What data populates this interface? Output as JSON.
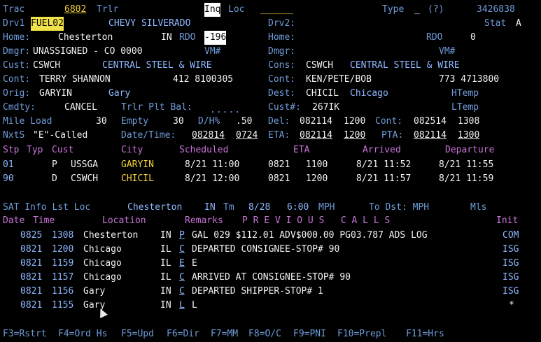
{
  "header": {
    "trac_label": "Trac",
    "trac_value": "6802",
    "trlr_label": "Trlr",
    "inq_label": "Inq",
    "loc_label": "Loc",
    "type_label": "Type",
    "help": "(?)",
    "record_id": "3426838"
  },
  "drv1": {
    "label": "Drv1",
    "code": "FUEL02",
    "vehicle": "CHEVY SILVERADO"
  },
  "drv2": {
    "label": "Drv2:",
    "stat_label": "Stat",
    "stat_value": "A"
  },
  "home_left": {
    "label": "Home:",
    "city": "Chesterton",
    "state": "IN",
    "rdo_label": "RDO",
    "rdo_value": "-196"
  },
  "home_right": {
    "label": "Home:",
    "rdo_label": "RDO",
    "rdo_value": "0"
  },
  "dmgr_left": {
    "label": "Dmgr:",
    "value": "UNASSIGNED - CO 0000",
    "vm_label": "VM#"
  },
  "dmgr_right": {
    "label": "Dmgr:",
    "vm_label": "VM#"
  },
  "cust": {
    "label": "Cust:",
    "code": "CSWCH",
    "name": "CENTRAL STEEL & WIRE"
  },
  "cons": {
    "label": "Cons:",
    "code": "CSWCH",
    "name": "CENTRAL STEEL & WIRE"
  },
  "cont_left": {
    "label": "Cont:",
    "name": "TERRY SHANNON",
    "phone": "412 8100305"
  },
  "cont_right": {
    "label": "Cont:",
    "name": "KEN/PETE/BOB",
    "phone": "773 4713800"
  },
  "orig": {
    "label": "Orig:",
    "code": "GARYIN",
    "city": "Gary"
  },
  "dest": {
    "label": "Dest:",
    "code": "CHICIL",
    "city": "Chicago",
    "htemp_label": "HTemp"
  },
  "cmdty": {
    "label": "Cmdty:",
    "value": "CANCEL",
    "trlr_plt_label": "Trlr Plt Bal:"
  },
  "custnum": {
    "label": "Cust#:",
    "value": "267IK",
    "ltemp_label": "LTemp"
  },
  "mile": {
    "label": "Mile Load",
    "load": "30",
    "empty_label": "Empty",
    "empty": "30",
    "dh_label": "D/H%",
    "dh": ".50"
  },
  "del": {
    "label": "Del:",
    "date": "082114",
    "time": "1200",
    "cont_label": "Cont:",
    "cont_date": "082514",
    "cont_time": "1308"
  },
  "nxts": {
    "label": "NxtS",
    "value": "\"E\"-Called",
    "dt_label": "Date/Time:",
    "date": "082814",
    "time": "0724"
  },
  "eta": {
    "label": "ETA:",
    "date": "082114",
    "time": "1200",
    "pta_label": "PTA:",
    "pta_date": "082114",
    "pta_time": "1300"
  },
  "stops": {
    "headers": [
      "Stp",
      "Typ",
      "Cust",
      "City",
      "Scheduled",
      "ETA",
      "Arrived",
      "Departure"
    ],
    "rows": [
      {
        "stp": "01",
        "typ": "P",
        "cust": "USSGA",
        "city": "GARYIN",
        "sched": "8/21 11:00",
        "eta_d": "0821",
        "eta_t": "1100",
        "arrived": "8/21 11:52",
        "depart": "8/21 11:55"
      },
      {
        "stp": "90",
        "typ": "D",
        "cust": "CSWCH",
        "city": "CHICIL",
        "sched": "8/21 12:00",
        "eta_d": "0821",
        "eta_t": "1200",
        "arrived": "8/21 11:57",
        "depart": "8/21 11:59"
      }
    ]
  },
  "sat": {
    "label": "SAT Info Lst Loc",
    "city": "Chesterton",
    "state": "IN",
    "tm_label": "Tm",
    "date": "8/28",
    "time": "6:00",
    "mph_label": "MPH",
    "todst_label": "To Dst: MPH",
    "mls_label": "Mls"
  },
  "calls": {
    "headers": {
      "date": "Date",
      "time": "Time",
      "location": "Location",
      "remarks": "Remarks",
      "title": "P R E V I O U S   C A L L S",
      "init": "Init"
    },
    "rows": [
      {
        "date": "0825",
        "time": "1308",
        "city": "Chesterton",
        "st": "IN",
        "code": "P",
        "remark": "GAL 029 $112.01 ADV$000.00 PG03.787 ADS LOG",
        "init": "COM"
      },
      {
        "date": "0821",
        "time": "1200",
        "city": "Chicago",
        "st": "IL",
        "code": "C",
        "remark": "DEPARTED CONSIGNEE-STOP# 90",
        "init": "ISG"
      },
      {
        "date": "0821",
        "time": "1159",
        "city": "Chicago",
        "st": "IL",
        "code": "E",
        "remark": "E",
        "init": "ISG"
      },
      {
        "date": "0821",
        "time": "1157",
        "city": "Chicago",
        "st": "IL",
        "code": "C",
        "remark": "ARRIVED AT CONSIGNEE-STOP# 90",
        "init": "ISG"
      },
      {
        "date": "0821",
        "time": "1156",
        "city": "Gary",
        "st": "IN",
        "code": "C",
        "remark": "DEPARTED SHIPPER-STOP# 1",
        "init": "ISG"
      },
      {
        "date": "0821",
        "time": "1155",
        "city": "Gary",
        "st": "IN",
        "code": "L",
        "remark": "L",
        "init": "*"
      }
    ]
  },
  "fkeys": [
    "F3=Rstrt",
    "F4=Ord Hs",
    "F5=Upd",
    "F6=Dir",
    "F7=MM",
    "F8=O/C",
    "F9=PNI",
    "F10=Prepl",
    "F11=Hrs"
  ],
  "colors": {
    "label": "#6f9bd8",
    "data": "#f2f2f2",
    "header": "#c874d8",
    "highlight": "#f2e24a"
  }
}
